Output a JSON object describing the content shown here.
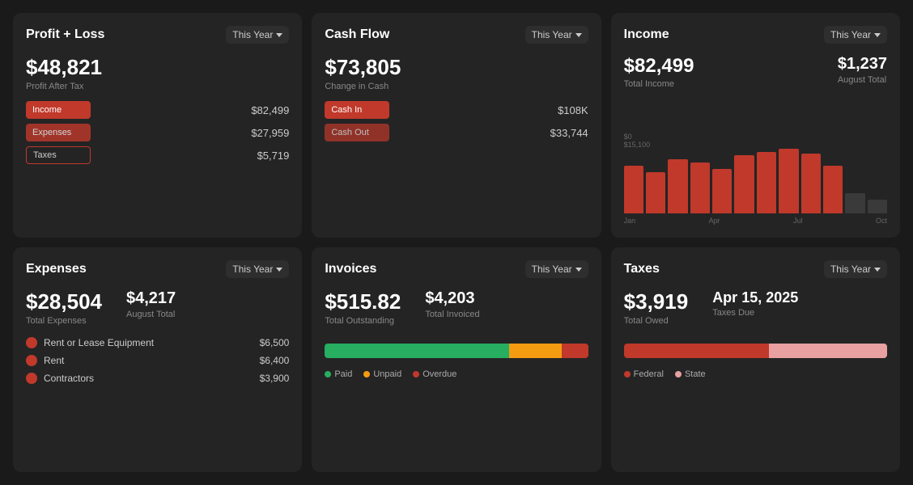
{
  "cards": {
    "profit_loss": {
      "title": "Profit + Loss",
      "period": "This Year",
      "main_value": "$48,821",
      "main_label": "Profit After Tax",
      "rows": [
        {
          "label": "Income",
          "bar_class": "income",
          "value": "$82,499"
        },
        {
          "label": "Expenses",
          "bar_class": "expenses",
          "value": "$27,959"
        },
        {
          "label": "Taxes",
          "bar_class": "taxes",
          "value": "$5,719"
        }
      ]
    },
    "cash_flow": {
      "title": "Cash Flow",
      "period": "This Year",
      "main_value": "$73,805",
      "main_label": "Change in Cash",
      "rows": [
        {
          "label": "Cash In",
          "bar_class": "cash-in",
          "value": "$108K"
        },
        {
          "label": "Cash Out",
          "bar_class": "cash-out",
          "value": "$33,744"
        }
      ]
    },
    "income": {
      "title": "Income",
      "period": "This Year",
      "main_value": "$82,499",
      "main_label": "Total Income",
      "secondary_value": "$1,237",
      "secondary_label": "August Total",
      "chart_y_label": "$15,100",
      "chart_y_zero": "$0",
      "chart_bars": [
        70,
        60,
        80,
        75,
        65,
        85,
        90,
        95,
        88,
        70,
        30,
        20
      ],
      "x_labels": [
        "Jan",
        "Apr",
        "Jul",
        "Oct"
      ]
    },
    "expenses": {
      "title": "Expenses",
      "period": "This Year",
      "main_value": "$28,504",
      "main_label": "Total Expenses",
      "secondary_value": "$4,217",
      "secondary_label": "August Total",
      "rows": [
        {
          "label": "Rent or Lease Equipment",
          "value": "$6,500"
        },
        {
          "label": "Rent",
          "value": "$6,400"
        },
        {
          "label": "Contractors",
          "value": "$3,900"
        }
      ]
    },
    "invoices": {
      "title": "Invoices",
      "period": "This Year",
      "main_value": "$515.82",
      "main_label": "Total Outstanding",
      "secondary_value": "$4,203",
      "secondary_label": "Total Invoiced",
      "bar": {
        "paid_pct": 70,
        "unpaid_pct": 20,
        "overdue_pct": 10
      },
      "legend": [
        {
          "label": "Paid",
          "color": "#27ae60"
        },
        {
          "label": "Unpaid",
          "color": "#f39c12"
        },
        {
          "label": "Overdue",
          "color": "#c0392b"
        }
      ]
    },
    "taxes": {
      "title": "Taxes",
      "period": "This Year",
      "main_value": "$3,919",
      "main_label": "Total Owed",
      "secondary_value": "Apr 15, 2025",
      "secondary_label": "Taxes Due",
      "bar": {
        "federal_pct": 55,
        "state_pct": 45
      },
      "legend": [
        {
          "label": "Federal",
          "color": "#c0392b"
        },
        {
          "label": "State",
          "color": "#e8a0a0"
        }
      ]
    }
  }
}
